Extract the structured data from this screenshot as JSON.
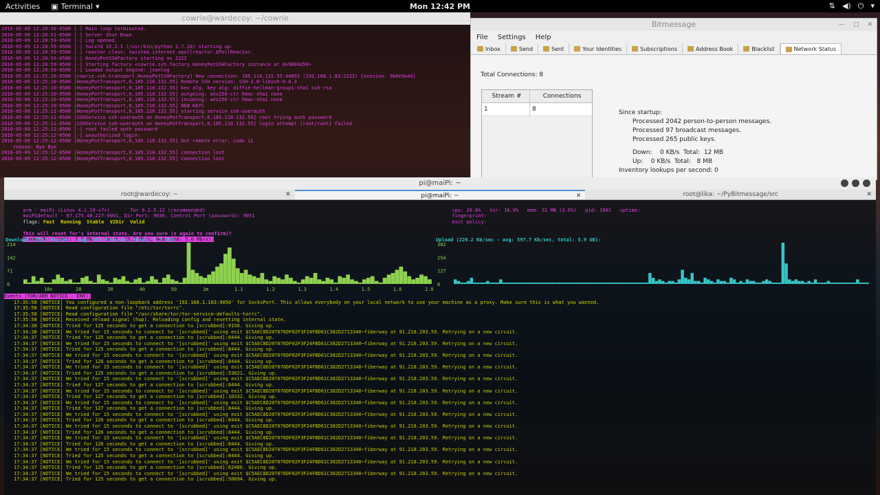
{
  "topbar": {
    "activities": "Activities",
    "app": "Terminal",
    "clock": "Mon 12:42 PM"
  },
  "cowrie": {
    "title": "cowrie@wardecoy: ~/cowrie",
    "lines": [
      "2016-05-09 12:20:50-0500 [-] Main loop terminated.",
      "2016-05-09 12:20:51-0500 [-] Server Shut Down.",
      "2016-05-09 12:20:59-0500 [-] Log opened.",
      "2016-05-09 12:20:59-0500 [-] twistd 15.2.1 (/usr/bin/python 2.7.10) starting up.",
      "2016-05-09 12:20:59-0500 [-] reactor class: twisted.internet.epollreactor.EPollReactor.",
      "2016-05-09 12:20:59-0500 [-] HoneyPotSSHFactory starting on 2222",
      "2016-05-09 12:20:59-0500 [-] Starting factory <cowrie.ssh.factory.HoneyPotSSHFactory instance at 0x9069d50>",
      "2016-05-09 12:20:59-0500 [-] Loaded output engine: jsonlog",
      "2016-05-09 12:25:10-0500 [cowrie.ssh.transport.HoneyPotSSHFactory] New connection: 185.110.132.55:44893 (192.168.1.83:2222) [session: 9b0e9a4d]",
      "2016-05-09 12:25:10-0500 [HoneyPotTransport,0,185.110.132.55] Remote SSH version: SSH-2.0-libssh-0.6.3",
      "2016-05-09 12:25:10-0500 [HoneyPotTransport,0,185.110.132.55] kex alg, key alg: diffie-hellman-group1-sha1 ssh-rsa",
      "2016-05-09 12:25:10-0500 [HoneyPotTransport,0,185.110.132.55] outgoing: aes256-ctr hmac-sha1 none",
      "2016-05-09 12:25:10-0500 [HoneyPotTransport,0,185.110.132.55] incoming: aes256-ctr hmac-sha1 none",
      "2016-05-09 12:25:10-0500 [HoneyPotTransport,0,185.110.132.55] NEW KEYS",
      "2016-05-09 12:25:11-0500 [HoneyPotTransport,0,185.110.132.55] starting service ssh-userauth",
      "2016-05-09 12:25:11-0500 [SSHService ssh-userauth on HoneyPotTransport,0,185.110.132.55] root trying auth password",
      "2016-05-09 12:25:11-0500 [SSHService ssh-userauth on HoneyPotTransport,0,185.110.132.55] login attempt [root/root] failed",
      "2016-05-09 12:25:12-0500 [-] root failed auth password",
      "2016-05-09 12:25:12-0500 [-] unauthorized login:",
      "2016-05-09 12:25:12-0500 [HoneyPotTransport,0,185.110.132.55] Got remote error, code 11",
      "    reason: Bye Bye",
      "2016-05-09 12:25:12-0500 [HoneyPotTransport,0,185.110.132.55] connection lost",
      "2016-05-09 12:25:12-0500 [HoneyPotTransport,0,185.110.132.55] Connection lost"
    ]
  },
  "bitmessage": {
    "title": "Bitmessage",
    "menu": [
      "File",
      "Settings",
      "Help"
    ],
    "tabs": [
      "Inbox",
      "Send",
      "Sent",
      "Your Identities",
      "Subscriptions",
      "Address Book",
      "Blacklist",
      "Network Status"
    ],
    "total_connections": "Total Connections: 8",
    "table": {
      "headers": [
        "Stream #",
        "Connections"
      ],
      "rows": [
        [
          "1",
          "8"
        ]
      ]
    },
    "since": "Since startup:",
    "stats": [
      "Processed 2042 person-to-person messages.",
      "Processed 97 broadcast messages.",
      "Processed 265 public keys."
    ],
    "down": "Down:    0 KB/s  Total:  12 MB",
    "up": "Up:    0 KB/s  Total:   8 MB",
    "inventory": "Inventory lookups per second: 0"
  },
  "terminal": {
    "title": "pi@maiPi: ~",
    "tabs": [
      "root@wardecoy: ~",
      "pi@maiPi: ~",
      "root@lika: ~/PyBitmessage/src"
    ],
    "arm": {
      "hdr1": "arm - maiPi (Linux 4.1.19-v7+)       Tor 0.2.5.12 (recommended)",
      "hdr2": "maiPIdefault - 67.175.48.227:9001, Dir Port: 9030, Control Port (password): 9051",
      "flags_label": "flags: ",
      "flags": "Fast  Running  Stable  V2Dir  Valid",
      "right1": "cpu: 20.0%   tor: 16.9%   mem: 31 MB (3.6%)   pid: 1001   uptime: ",
      "right2": "fingerprint: ",
      "right3": "exit policy: ",
      "warning": "This will reset Tor's internal state. Are you sure (x again to confirm)?",
      "bandwidth": "Bandwidth (limit: 7.6 Mb/s, burst: 15.2 Mb/s, measured: 5.6 Mb/s):",
      "download": "Download (158.5 Kb/sec - avg: 587.0 Kb/sec, total: 5.7 GB):",
      "upload": "Upload (220.2 Kb/sec - avg: 597.7 Kb/sec, total: 5.9 GB):",
      "dl_ticks": [
        "214",
        "142",
        "71",
        "0"
      ],
      "ul_ticks": [
        "382",
        "254",
        "127",
        "0"
      ],
      "dl_xticks": [
        "10s",
        "20",
        "30",
        "40",
        "50",
        "1m",
        "1.1",
        "1.2",
        "1.3",
        "1.4",
        "1.5",
        "1.6",
        "2.0"
      ],
      "dl_values": [
        2,
        0,
        4,
        1,
        3,
        0,
        0,
        2,
        5,
        3,
        1,
        2,
        0,
        0,
        3,
        4,
        1,
        0,
        5,
        2,
        1,
        0,
        3,
        2,
        4,
        1,
        0,
        2,
        3,
        0,
        1,
        4,
        2,
        0,
        3,
        5,
        2,
        1,
        0,
        3,
        25,
        8,
        6,
        4,
        3,
        5,
        7,
        10,
        12,
        18,
        22,
        15,
        9,
        6,
        8,
        5,
        4,
        3,
        6,
        2,
        1,
        4,
        3,
        2,
        5,
        3,
        1,
        0,
        2,
        4,
        3,
        6,
        2,
        1,
        3,
        2,
        0,
        4,
        3,
        5,
        2,
        1,
        0,
        2,
        3,
        4,
        1,
        0,
        3,
        5,
        6,
        8,
        10,
        7,
        4,
        2,
        3,
        5,
        4,
        2
      ],
      "ul_values": [
        2,
        1,
        0,
        0,
        1,
        3,
        0,
        0,
        0,
        0,
        1,
        0,
        0,
        0,
        2,
        0,
        0,
        0,
        0,
        0,
        0,
        0,
        0,
        0,
        0,
        0,
        0,
        0,
        0,
        0,
        0,
        0,
        0,
        0,
        0,
        0,
        0,
        0,
        0,
        0,
        0,
        0,
        0,
        0,
        0,
        0,
        0,
        0,
        0,
        0,
        0,
        0,
        0,
        0,
        0,
        0,
        0,
        0,
        0,
        0,
        6,
        3,
        1,
        2,
        1,
        0,
        1,
        1,
        0,
        2,
        8,
        3,
        2,
        6,
        1,
        1,
        0,
        3,
        2,
        1,
        0,
        2,
        1,
        1,
        0,
        3,
        2,
        0,
        1,
        0,
        2,
        1,
        1,
        0,
        0,
        1,
        2,
        1,
        0,
        0,
        0,
        25,
        12,
        2,
        1,
        2,
        1,
        1,
        0,
        1,
        0,
        2,
        0,
        0,
        0,
        1,
        0,
        0,
        0,
        0,
        0,
        0,
        0,
        0,
        2,
        0,
        0,
        0
      ],
      "events_label": "Events (TOR/ARM NOTICE - ERR):",
      "events": [
        "17:35:58 [NOTICE] You configured a non-loopback address '192.168.1.163:9050' for SocksPort. This allows everybody on your local network to use your machine as a proxy. Make sure this is what you wanted.",
        "17:35:58 [NOTICE] Read configuration file \"/etc/tor/torrc\".",
        "17:35:58 [NOTICE] Read configuration file \"/usr/share/tor/tor-service-defaults-torrc\".",
        "17:35:58 [NOTICE] Received reload signal (hup). Reloading config and resetting internal state.",
        "17:34:38 [NOTICE] Tried for 125 seconds to get a connection to [scrubbed]:9150. Giving up.",
        "17:34:38 [NOTICE] We tried for 15 seconds to connect to '[scrubbed]' using exit $C5AEC8D207076DF02F3F24FBD61C382D2713340~fiberway at 91.218.203.59. Retrying on a new circuit.",
        "17:34:37 [NOTICE] Tried for 125 seconds to get a connection to [scrubbed]:8444. Giving up.",
        "17:34:37 [NOTICE] We tried for 15 seconds to connect to '[scrubbed]' using exit $C5AEC8D207076DF02F3F24FBD61C382D2713340~fiberway at 91.218.203.59. Retrying on a new circuit.",
        "17:34:37 [NOTICE] Tried for 125 seconds to get a connection to [scrubbed]:8444. Giving up.",
        "17:34:37 [NOTICE] We tried for 15 seconds to connect to '[scrubbed]' using exit $C5AEC8D207076DF02F3F24FBD61C382D2713340~fiberway at 91.218.203.59. Retrying on a new circuit.",
        "17:34:37 [NOTICE] Tried for 126 seconds to get a connection to [scrubbed]:8444. Giving up.",
        "17:34:37 [NOTICE] We tried for 15 seconds to connect to '[scrubbed]' using exit $C5AEC8D207076DF02F3F24FBD61C382D2713340~fiberway at 91.218.203.59. Retrying on a new circuit.",
        "17:34:37 [NOTICE] Tried for 125 seconds to get a connection to [scrubbed]:53621. Giving up.",
        "17:34:37 [NOTICE] We tried for 15 seconds to connect to '[scrubbed]' using exit $C5AEC8D207076DF02F3F24FBD61C382D2713340~fiberway at 91.218.203.59. Retrying on a new circuit.",
        "17:34:37 [NOTICE] Tried for 127 seconds to get a connection to [scrubbed]:8444. Giving up.",
        "17:34:37 [NOTICE] We tried for 15 seconds to connect to '[scrubbed]' using exit $C5AEC8D207076DF02F3F24FBD61C382D2713340~fiberway at 91.218.203.59. Retrying on a new circuit.",
        "17:34:37 [NOTICE] Tried for 127 seconds to get a connection to [scrubbed]:10332. Giving up.",
        "17:34:37 [NOTICE] We tried for 15 seconds to connect to '[scrubbed]' using exit $C5AEC8D207076DF02F3F24FBD61C382D2713340~fiberway at 91.218.203.59. Retrying on a new circuit.",
        "17:34:37 [NOTICE] Tried for 127 seconds to get a connection to [scrubbed]:8444. Giving up.",
        "17:34:37 [NOTICE] We tried for 15 seconds to connect to '[scrubbed]' using exit $C5AEC8D207076DF02F3F24FBD61C382D2713340~fiberway at 91.218.203.59. Retrying on a new circuit.",
        "17:34:37 [NOTICE] Tried for 126 seconds to get a connection to [scrubbed]:8444. Giving up.",
        "17:34:37 [NOTICE] We tried for 15 seconds to connect to '[scrubbed]' using exit $C5AEC8D207076DF02F3F24FBD61C382D2713340~fiberway at 91.218.203.59. Retrying on a new circuit.",
        "17:34:37 [NOTICE] Tried for 126 seconds to get a connection to [scrubbed]:8444. Giving up.",
        "17:34:37 [NOTICE] We tried for 15 seconds to connect to '[scrubbed]' using exit $C5AEC8D207076DF02F3F24FBD61C382D2713340~fiberway at 91.218.203.59. Retrying on a new circuit.",
        "17:34:37 [NOTICE] Tried for 126 seconds to get a connection to [scrubbed]:8444. Giving up.",
        "17:34:37 [NOTICE] We tried for 15 seconds to connect to '[scrubbed]' using exit $C5AEC8D207076DF02F3F24FBD61C382D2713340~fiberway at 91.218.203.59. Retrying on a new circuit.",
        "17:34:37 [NOTICE] Tried for 125 seconds to get a connection to [scrubbed]:8444. Giving up.",
        "17:34:37 [NOTICE] We tried for 15 seconds to connect to '[scrubbed]' using exit $C5AEC8D207076DF02F3F24FBD61C382D2713340~fiberway at 91.218.203.59. Retrying on a new circuit.",
        "17:34:37 [NOTICE] Tried for 125 seconds to get a connection to [scrubbed]:62486. Giving up.",
        "17:34:37 [NOTICE] We tried for 15 seconds to connect to '[scrubbed]' using exit $C5AEC8D207076DF02F3F24FBD61C382D2713340~fiberway at 91.218.203.59. Retrying on a new circuit.",
        "17:34:37 [NOTICE] Tried for 125 seconds to get a connection to [scrubbed]:50694. Giving up."
      ]
    }
  },
  "colors": {
    "arm_green": "#8fd14f",
    "arm_cyan": "#36c6c6",
    "arm_magenta": "#e040e0"
  }
}
